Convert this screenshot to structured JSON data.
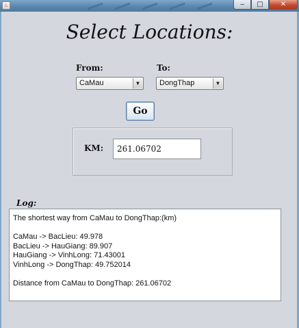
{
  "heading": "Select Locations:",
  "from": {
    "label": "From:",
    "value": "CaMau"
  },
  "to": {
    "label": "To:",
    "value": "DongThap"
  },
  "go_label": "Go",
  "km": {
    "label": "KM:",
    "value": "261.06702"
  },
  "log": {
    "label": "Log:",
    "lines": [
      "The shortest way from CaMau to DongThap:(km)",
      "",
      "CaMau -> BacLieu: 49.978",
      "BacLieu -> HauGiang: 89.907",
      "HauGiang -> VinhLong: 71.43001",
      "VinhLong -> DongThap: 49.752014",
      "",
      "Distance from CaMau to DongThap: 261.06702"
    ]
  },
  "window": {
    "minimize": "‒",
    "maximize": "□",
    "close": "✕"
  },
  "colors": {
    "background": "#d4d8de",
    "titlebar": "#5b87ad",
    "close_button": "#c4472a"
  }
}
